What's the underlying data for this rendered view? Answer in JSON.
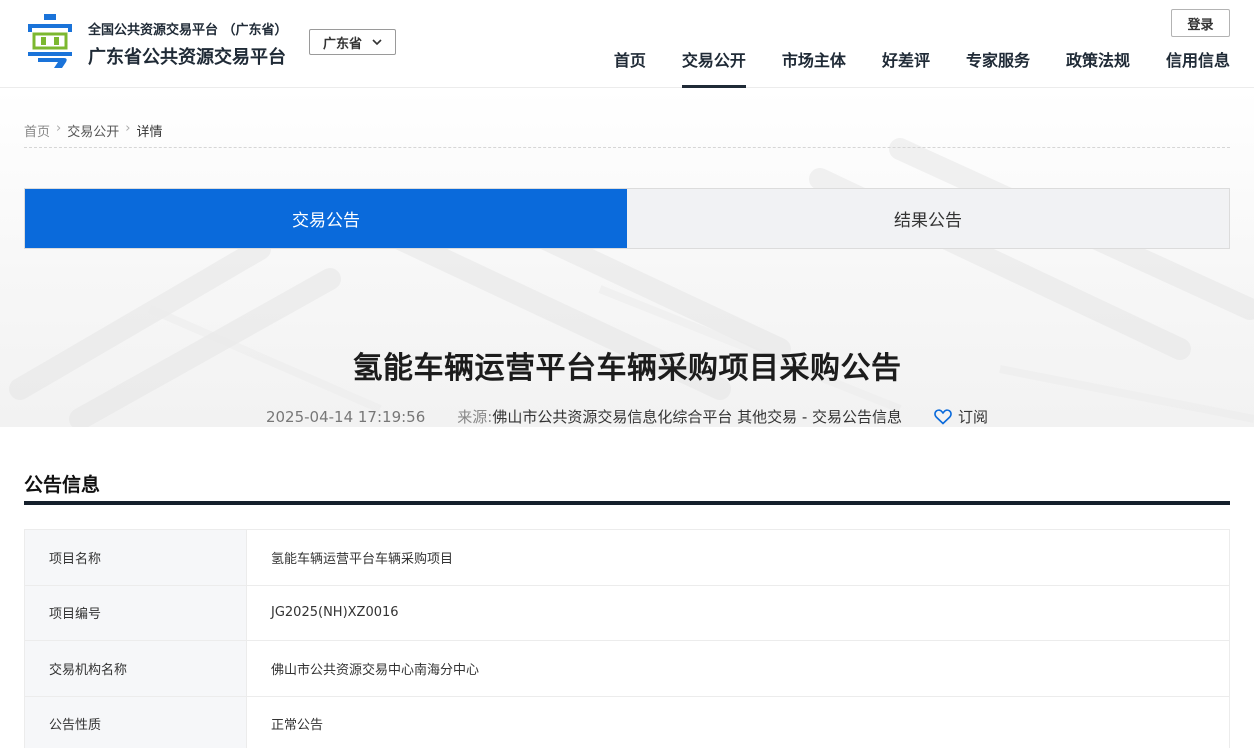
{
  "header": {
    "site_subtitle": "全国公共资源交易平台 （广东省）",
    "site_title": "广东省公共资源交易平台",
    "region": "广东省",
    "login_label": "登录",
    "nav": [
      {
        "label": "首页",
        "active": false
      },
      {
        "label": "交易公开",
        "active": true
      },
      {
        "label": "市场主体",
        "active": false
      },
      {
        "label": "好差评",
        "active": false
      },
      {
        "label": "专家服务",
        "active": false
      },
      {
        "label": "政策法规",
        "active": false
      },
      {
        "label": "信用信息",
        "active": false
      }
    ]
  },
  "breadcrumb": {
    "home": "首页",
    "section": "交易公开",
    "current": "详情"
  },
  "tabs": [
    {
      "label": "交易公告",
      "active": true
    },
    {
      "label": "结果公告",
      "active": false
    }
  ],
  "article": {
    "title": "氢能车辆运营平台车辆采购项目采购公告",
    "time": "2025-04-14 17:19:56",
    "source_label": "来源:",
    "source": "佛山市公共资源交易信息化综合平台 其他交易 - 交易公告信息",
    "subscribe_label": "订阅"
  },
  "info": {
    "heading": "公告信息",
    "rows": [
      {
        "key": "项目名称",
        "value": "氢能车辆运营平台车辆采购项目"
      },
      {
        "key": "项目编号",
        "value": "JG2025(NH)XZ0016"
      },
      {
        "key": "交易机构名称",
        "value": "佛山市公共资源交易中心南海分中心"
      },
      {
        "key": "公告性质",
        "value": "正常公告"
      }
    ]
  },
  "colors": {
    "accent": "#0a6adb",
    "logo_blue": "#1a73d9",
    "logo_green": "#7cb82f",
    "dark": "#15202b"
  },
  "icons": {
    "region_dropdown": "chevron-down-icon",
    "subscribe": "heart-icon",
    "logo": "site-logo-icon"
  }
}
